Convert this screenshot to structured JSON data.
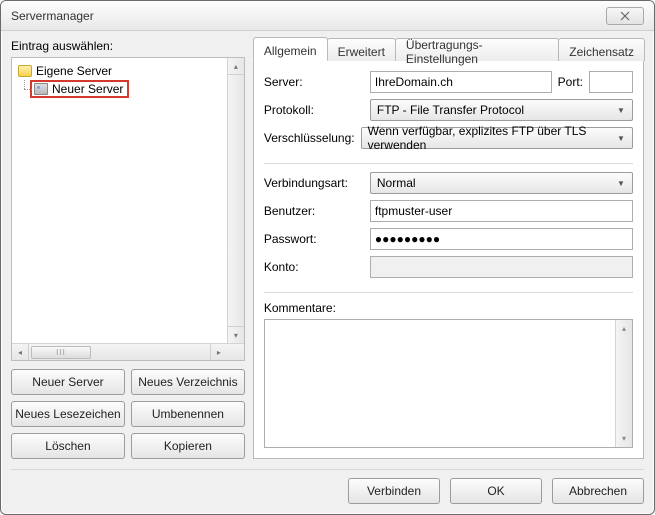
{
  "window": {
    "title": "Servermanager"
  },
  "left": {
    "label": "Eintrag auswählen:",
    "root_label": "Eigene Server",
    "selected_label": "Neuer Server",
    "hscroll_grip": "III",
    "buttons": {
      "new_server": "Neuer Server",
      "new_folder": "Neues Verzeichnis",
      "new_bookmark": "Neues Lesezeichen",
      "rename": "Umbenennen",
      "delete": "Löschen",
      "copy": "Kopieren"
    }
  },
  "tabs": {
    "general": "Allgemein",
    "advanced": "Erweitert",
    "transfer": "Übertragungs-Einstellungen",
    "charset": "Zeichensatz"
  },
  "form": {
    "server_label": "Server:",
    "server_value": "IhreDomain.ch",
    "port_label": "Port:",
    "port_value": "",
    "protocol_label": "Protokoll:",
    "protocol_value": "FTP - File Transfer Protocol",
    "encryption_label": "Verschlüsselung:",
    "encryption_value": "Wenn verfügbar, explizites FTP über TLS verwenden",
    "conn_label": "Verbindungsart:",
    "conn_value": "Normal",
    "user_label": "Benutzer:",
    "user_value": "ftpmuster-user",
    "pass_label": "Passwort:",
    "pass_value": "●●●●●●●●●",
    "account_label": "Konto:",
    "account_value": "",
    "comments_label": "Kommentare:"
  },
  "footer": {
    "connect": "Verbinden",
    "ok": "OK",
    "cancel": "Abbrechen"
  }
}
